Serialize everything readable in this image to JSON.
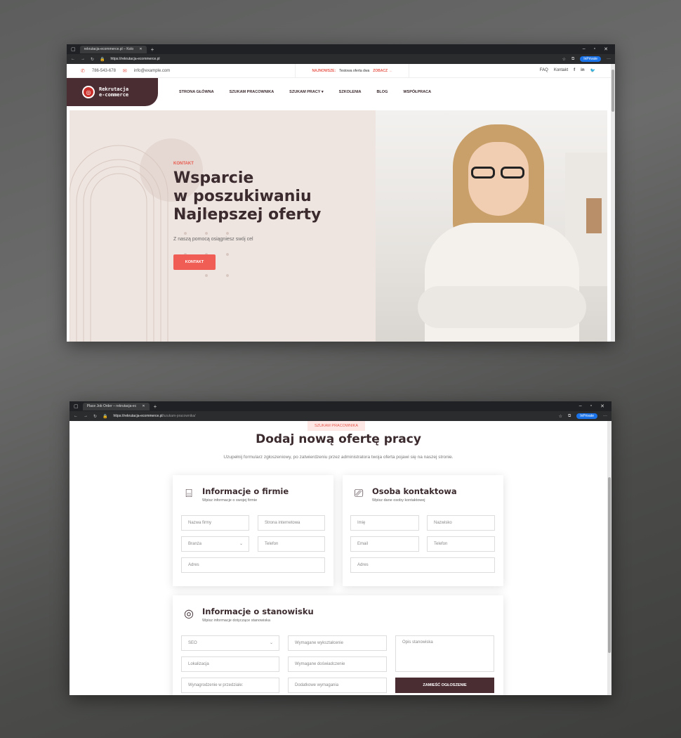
{
  "window1": {
    "tab_title": "rekrutacja-ecommerce.pl – Kolo",
    "url": "https://rekrutacja-ecommerce.pl",
    "inprivate": "InPrivate",
    "topbar": {
      "phone": "786-543-678",
      "email": "info@example.com",
      "news_label": "NAJNOWSZE:",
      "news_text": "Testowa oferta dwa",
      "news_link": "ZOBACZ →",
      "faq": "FAQ",
      "contact": "Kontakt"
    },
    "logo": {
      "line1": "Rekrutacja",
      "line2": "e-commerce"
    },
    "menu": [
      "STRONA GŁÓWNA",
      "SZUKAM PRACOWNIKA",
      "SZUKAM PRACY ▾",
      "SZKOLENIA",
      "BLOG",
      "WSPÓŁPRACA"
    ],
    "hero": {
      "kicker": "KONTAKT",
      "title_l1": "Wsparcie",
      "title_l2": "w poszukiwaniu",
      "title_l3": "Najlepszej oferty",
      "subtitle": "Z naszą pomocą osiągniesz swój cel",
      "button": "KONTAKT"
    }
  },
  "window2": {
    "tab_title": "Place Job Order – rekrutacja-ec",
    "url_main": "https://rekrutacja-ecommerce.pl",
    "url_path": "/szukam-pracownika/",
    "inprivate": "InPrivate",
    "crumb": "SZUKAM PRACOWNIKA",
    "title": "Dodaj nową ofertę pracy",
    "subtitle": "Uzupełnij formularz zgłoszeniowy, po zatwierdzeniu przez administratora twoja oferta pojawi się na naszej stronie.",
    "company": {
      "title": "Informacje o firmie",
      "sub": "Wpisz informacje o swojej firmie",
      "f1": "Nazwa firmy",
      "f2": "Strona internetowa",
      "f3": "Branża",
      "f4": "Telefon",
      "f5": "Adres"
    },
    "contact": {
      "title": "Osoba kontaktowa",
      "sub": "Wpisz dane osoby kontaktowej",
      "f1": "Imię",
      "f2": "Nazwisko",
      "f3": "Email",
      "f4": "Telefon",
      "f5": "Adres"
    },
    "position": {
      "title": "Informacje o stanowisku",
      "sub": "Wpisz informacje dotyczące stanowiska",
      "f1": "SEO",
      "f2": "Wymagane wykształcenie",
      "f3": "Opis stanowiska",
      "f4": "Lokalizacja",
      "f5": "Wymagane doświadczenie",
      "f6": "Wynagrodzenie w przedziale:",
      "f7": "Dodatkowe wymagania",
      "submit": "ZAMIEŚĆ OGŁOSZENIE"
    }
  }
}
